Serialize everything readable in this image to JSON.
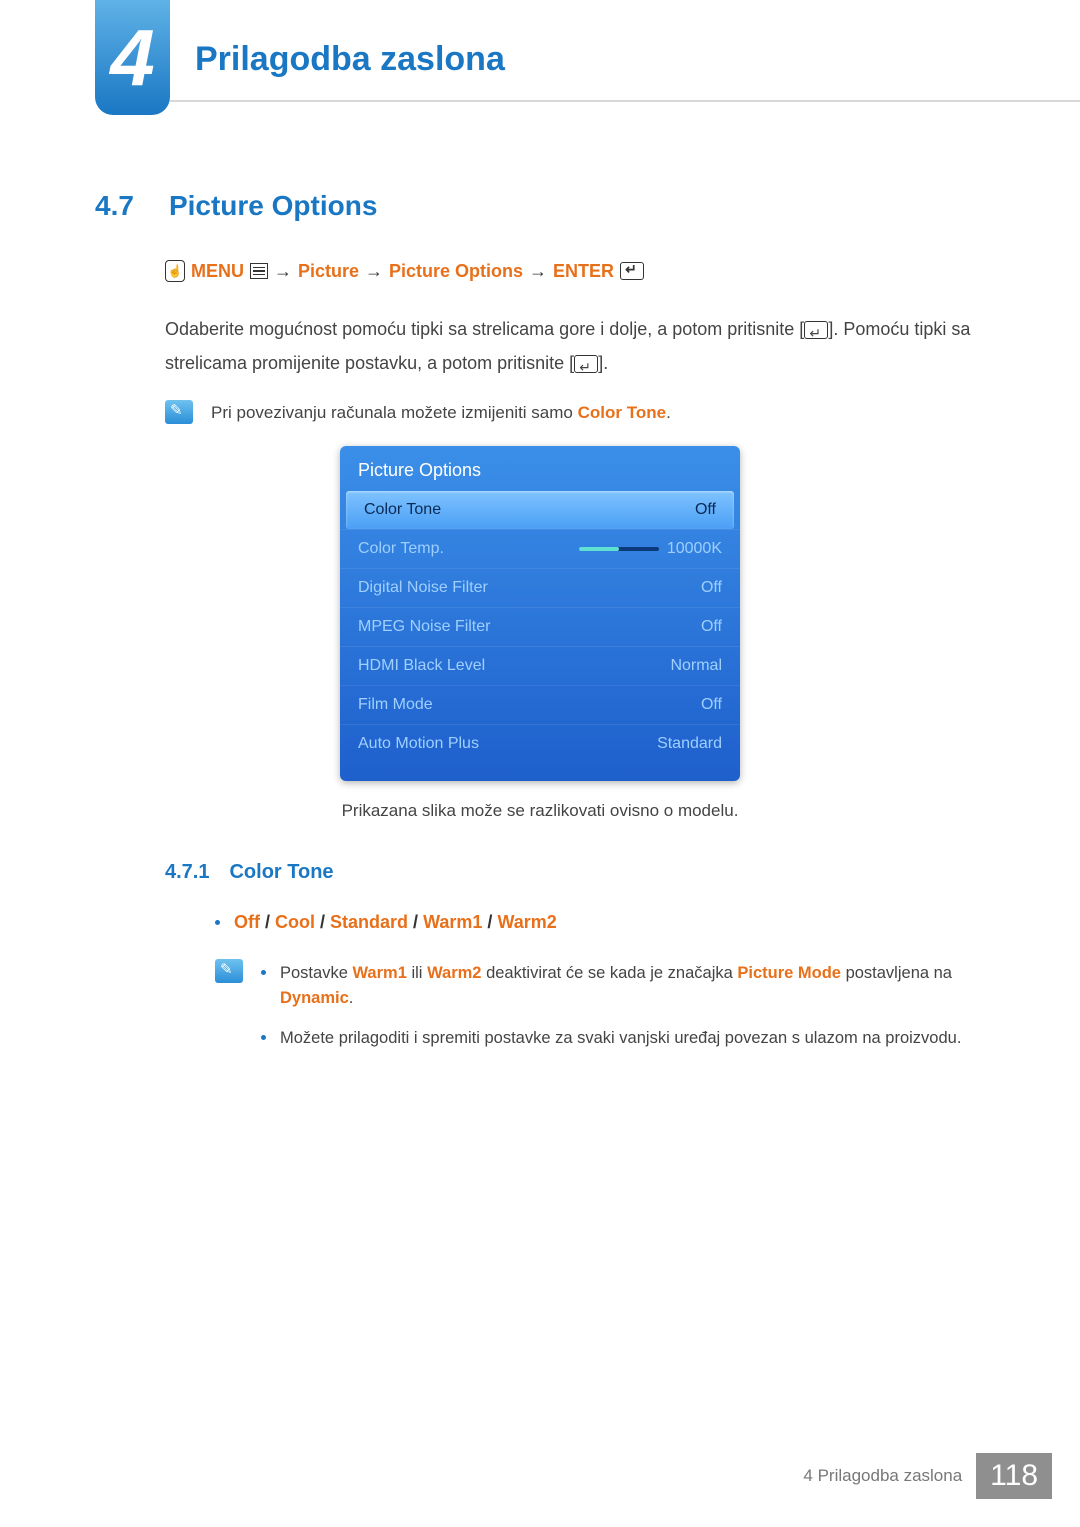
{
  "chapter": {
    "number": "4",
    "title": "Prilagodba zaslona"
  },
  "section": {
    "number": "4.7",
    "title": "Picture Options"
  },
  "breadcrumb": {
    "menu": "MENU",
    "arrow": "→",
    "p1": "Picture",
    "p2": "Picture Options",
    "enter": "ENTER"
  },
  "body": {
    "para1a": "Odaberite mogućnost pomoću tipki sa strelicama gore i dolje, a potom pritisnite [",
    "para1b": "]. Pomoću tipki sa strelicama promijenite postavku, a potom pritisnite [",
    "para1c": "]."
  },
  "note1": {
    "text_a": "Pri povezivanju računala možete izmijeniti samo ",
    "keyword": "Color Tone",
    "text_b": "."
  },
  "osd": {
    "title": "Picture Options",
    "rows": [
      {
        "label": "Color Tone",
        "value": "Off",
        "selected": true
      },
      {
        "label": "Color Temp.",
        "value": "10000K",
        "slider": true
      },
      {
        "label": "Digital Noise Filter",
        "value": "Off"
      },
      {
        "label": "MPEG Noise Filter",
        "value": "Off"
      },
      {
        "label": "HDMI Black Level",
        "value": "Normal"
      },
      {
        "label": "Film Mode",
        "value": "Off"
      },
      {
        "label": "Auto Motion Plus",
        "value": "Standard"
      }
    ]
  },
  "caption": "Prikazana slika može se razlikovati ovisno o modelu.",
  "subsection": {
    "number": "4.7.1",
    "title": "Color Tone"
  },
  "options": {
    "o1": "Off",
    "o2": "Cool",
    "o3": "Standard",
    "o4": "Warm1",
    "o5": "Warm2",
    "slash": " / "
  },
  "note2": {
    "item1_a": "Postavke ",
    "item1_b": "Warm1",
    "item1_c": " ili ",
    "item1_d": "Warm2",
    "item1_e": " deaktivirat će se kada je značajka ",
    "item1_f": "Picture Mode",
    "item1_g": " postavljena na ",
    "item1_h": "Dynamic",
    "item1_i": ".",
    "item2": "Možete prilagoditi i spremiti postavke za svaki vanjski uređaj povezan s ulazom na proizvodu."
  },
  "footer": {
    "text": "4 Prilagodba zaslona",
    "page": "118"
  }
}
